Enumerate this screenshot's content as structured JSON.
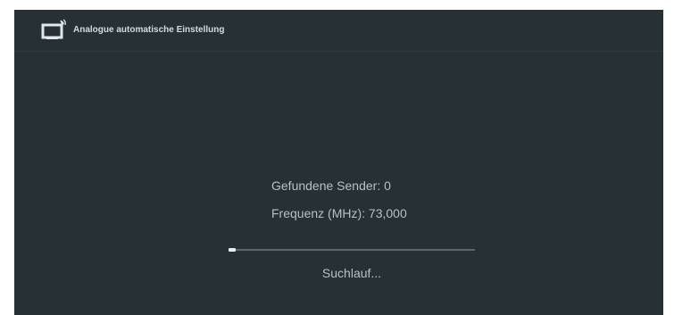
{
  "header": {
    "icon": "tv-antenna-icon",
    "title": "Analogue automatische Einstellung"
  },
  "scan": {
    "found_channels": "Gefundene Sender: 0",
    "frequency": "Frequenz (MHz): 73,000",
    "progress_fraction": 0.03,
    "status": "Suchlauf..."
  },
  "colors": {
    "background": "#263035",
    "text": "#b9c0c4",
    "progress_fill": "#e8ecee",
    "progress_track": "#5e676c"
  }
}
